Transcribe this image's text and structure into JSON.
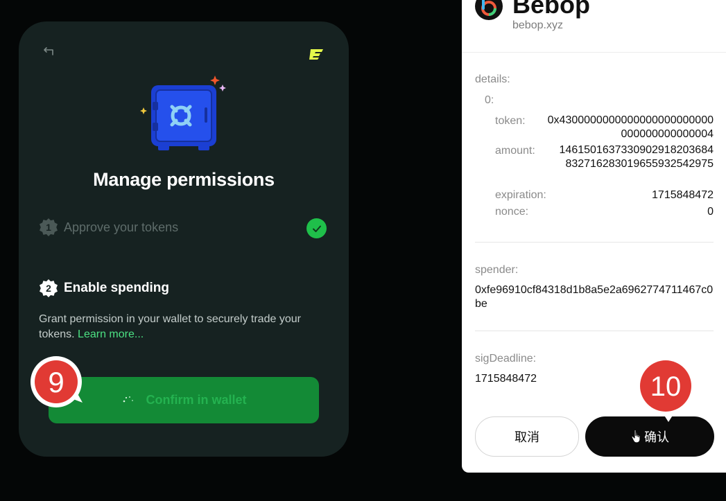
{
  "modal": {
    "title": "Manage permissions",
    "steps": [
      {
        "number": "1",
        "label": "Approve your tokens",
        "status": "complete"
      },
      {
        "number": "2",
        "label": "Enable spending",
        "status": "active"
      }
    ],
    "description": "Grant permission in your wallet to securely trade your tokens.",
    "learn_more": "Learn more...",
    "confirm_button": "Confirm in wallet",
    "icons": {
      "back": "back-arrow-icon",
      "brand": "bebop-logo-icon",
      "illustration": "safe-icon",
      "check": "check-icon",
      "spinner": "spinner-icon"
    },
    "colors": {
      "background": "#162221",
      "button": "#138a36",
      "accent": "#4ce183",
      "check": "#1fbf4a"
    }
  },
  "markers": {
    "left": "9",
    "right": "10"
  },
  "wallet": {
    "app_name": "Bebop",
    "domain": "bebop.xyz",
    "details_label": "details:",
    "index_label": "0:",
    "fields": [
      {
        "key": "token:",
        "value": "0x4300000000000000000000000000000000000004"
      },
      {
        "key": "amount:",
        "value": "1461501637330902918203684832716283019655932542975"
      },
      {
        "key": "expiration:",
        "value": "1715848472"
      },
      {
        "key": "nonce:",
        "value": "0"
      }
    ],
    "spender_label": "spender:",
    "spender_value": "0xfe96910cf84318d1b8a5e2a6962774711467c0be",
    "sig_deadline_label": "sigDeadline:",
    "sig_deadline_value": "1715848472",
    "cancel_button": "取消",
    "confirm_button": "确认"
  }
}
